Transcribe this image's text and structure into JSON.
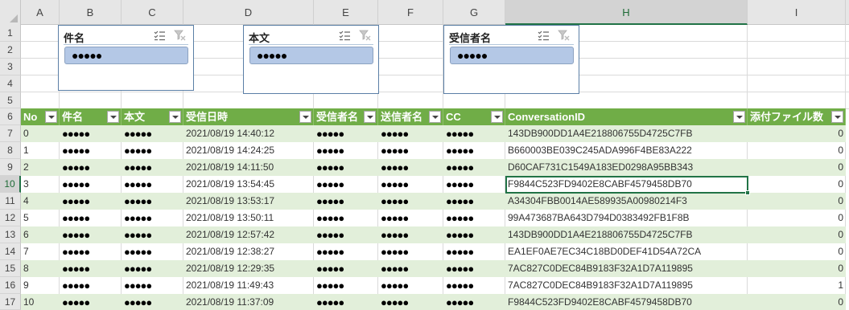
{
  "columns": [
    "A",
    "B",
    "C",
    "D",
    "E",
    "F",
    "G",
    "H",
    "I"
  ],
  "selected_column": "H",
  "row_numbers": [
    "1",
    "2",
    "3",
    "4",
    "5",
    "6",
    "7",
    "8",
    "9",
    "10",
    "11",
    "12",
    "13",
    "14",
    "15",
    "16",
    "17"
  ],
  "selected_row": "10",
  "slicers": [
    {
      "title": "件名",
      "item": "●●●●●"
    },
    {
      "title": "本文",
      "item": "●●●●●"
    },
    {
      "title": "受信者名",
      "item": "●●●●●"
    }
  ],
  "table": {
    "headers": [
      "No",
      "件名",
      "本文",
      "受信日時",
      "受信者名",
      "送信者名",
      "CC",
      "ConversationID",
      "添付ファイル数"
    ],
    "rows": [
      {
        "no": "0",
        "subject": "●●●●●",
        "body": "●●●●●",
        "received": "2021/08/19 14:40:12",
        "recipient": "●●●●●",
        "sender": "●●●●●",
        "cc": "●●●●●",
        "conv_id": "143DB900DD1A4E218806755D4725C7FB",
        "attachments": "0"
      },
      {
        "no": "1",
        "subject": "●●●●●",
        "body": "●●●●●",
        "received": "2021/08/19 14:24:25",
        "recipient": "●●●●●",
        "sender": "●●●●●",
        "cc": "●●●●●",
        "conv_id": "B660003BE039C245ADA996F4BE83A222",
        "attachments": "0"
      },
      {
        "no": "2",
        "subject": "●●●●●",
        "body": "●●●●●",
        "received": "2021/08/19 14:11:50",
        "recipient": "●●●●●",
        "sender": "●●●●●",
        "cc": "●●●●●",
        "conv_id": "D60CAF731C1549A183ED0298A95BB343",
        "attachments": "0"
      },
      {
        "no": "3",
        "subject": "●●●●●",
        "body": "●●●●●",
        "received": "2021/08/19 13:54:45",
        "recipient": "●●●●●",
        "sender": "●●●●●",
        "cc": "●●●●●",
        "conv_id": "F9844C523FD9402E8CABF4579458DB70",
        "attachments": "0"
      },
      {
        "no": "4",
        "subject": "●●●●●",
        "body": "●●●●●",
        "received": "2021/08/19 13:53:17",
        "recipient": "●●●●●",
        "sender": "●●●●●",
        "cc": "●●●●●",
        "conv_id": "A34304FBB0014AE589935A00980214F3",
        "attachments": "0"
      },
      {
        "no": "5",
        "subject": "●●●●●",
        "body": "●●●●●",
        "received": "2021/08/19 13:50:11",
        "recipient": "●●●●●",
        "sender": "●●●●●",
        "cc": "●●●●●",
        "conv_id": "99A473687BA643D794D0383492FB1F8B",
        "attachments": "0"
      },
      {
        "no": "6",
        "subject": "●●●●●",
        "body": "●●●●●",
        "received": "2021/08/19 12:57:42",
        "recipient": "●●●●●",
        "sender": "●●●●●",
        "cc": "●●●●●",
        "conv_id": "143DB900DD1A4E218806755D4725C7FB",
        "attachments": "0"
      },
      {
        "no": "7",
        "subject": "●●●●●",
        "body": "●●●●●",
        "received": "2021/08/19 12:38:27",
        "recipient": "●●●●●",
        "sender": "●●●●●",
        "cc": "●●●●●",
        "conv_id": "EA1EF0AE7EC34C18BD0DEF41D54A72CA",
        "attachments": "0"
      },
      {
        "no": "8",
        "subject": "●●●●●",
        "body": "●●●●●",
        "received": "2021/08/19 12:29:35",
        "recipient": "●●●●●",
        "sender": "●●●●●",
        "cc": "●●●●●",
        "conv_id": "7AC827C0DEC84B9183F32A1D7A119895",
        "attachments": "0"
      },
      {
        "no": "9",
        "subject": "●●●●●",
        "body": "●●●●●",
        "received": "2021/08/19 11:49:43",
        "recipient": "●●●●●",
        "sender": "●●●●●",
        "cc": "●●●●●",
        "conv_id": "7AC827C0DEC84B9183F32A1D7A119895",
        "attachments": "1"
      },
      {
        "no": "10",
        "subject": "●●●●●",
        "body": "●●●●●",
        "received": "2021/08/19 11:37:09",
        "recipient": "●●●●●",
        "sender": "●●●●●",
        "cc": "●●●●●",
        "conv_id": "F9844C523FD9402E8CABF4579458DB70",
        "attachments": "0"
      }
    ]
  },
  "icons": {
    "multi_select": "multi-select-icon",
    "clear_filter": "clear-filter-icon",
    "dropdown": "filter-dropdown-icon"
  },
  "colors": {
    "header_green": "#70ad47",
    "band_green": "#e2efda",
    "slicer_item": "#b4c8e6",
    "selection": "#217346"
  }
}
